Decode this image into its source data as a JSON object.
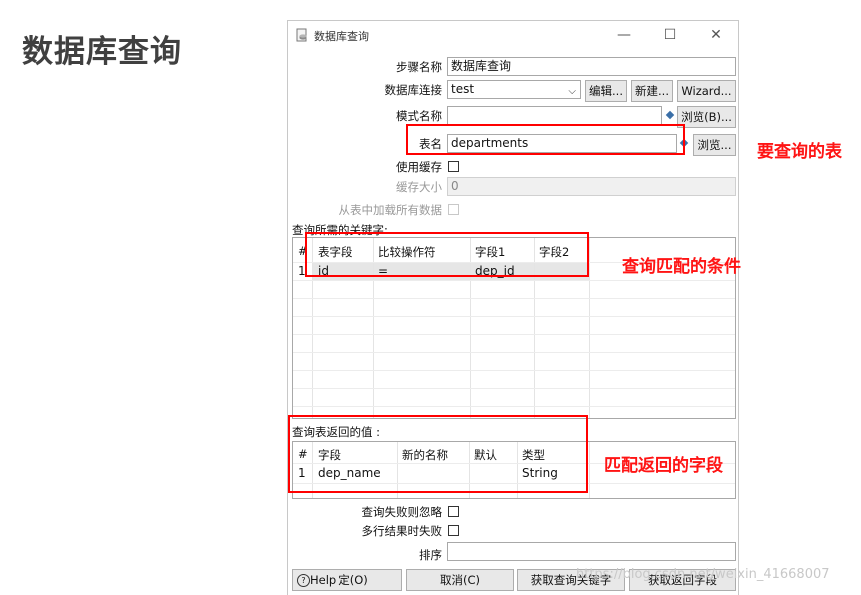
{
  "slide": {
    "title": "数据库查询"
  },
  "window": {
    "title": "数据库查询",
    "minimize": "—",
    "maximize": "☐",
    "close": "✕"
  },
  "form": {
    "step_name_label": "步骤名称",
    "step_name_value": "数据库查询",
    "connection_label": "数据库连接",
    "connection_value": "test",
    "edit_button": "编辑...",
    "new_button": "新建...",
    "wizard_button": "Wizard...",
    "schema_label": "模式名称",
    "schema_value": "",
    "browse_schema_button": "浏览(B)...",
    "table_label": "表名",
    "table_value": "departments",
    "browse_table_button": "浏览...",
    "use_cache_label": "使用缓存",
    "use_cache_checked": false,
    "cache_size_label": "缓存大小",
    "cache_size_value": "0",
    "load_all_label": "从表中加载所有数据",
    "load_all_checked": false
  },
  "keys_section": {
    "label": "查询所需的关键字:",
    "columns": [
      "#",
      "表字段",
      "比较操作符",
      "字段1",
      "字段2"
    ],
    "rows": [
      {
        "num": "1",
        "table_field": "id",
        "comparator": "=",
        "field1": "dep_id",
        "field2": ""
      }
    ]
  },
  "return_section": {
    "label": "查询表返回的值 :",
    "columns": [
      "#",
      "字段",
      "新的名称",
      "默认",
      "类型"
    ],
    "rows": [
      {
        "num": "1",
        "field": "dep_name",
        "new_name": "",
        "default": "",
        "type": "String"
      }
    ]
  },
  "options": {
    "fail_ignore_label": "查询失败则忽略",
    "fail_ignore_checked": false,
    "multi_fail_label": "多行结果时失败",
    "multi_fail_checked": false,
    "order_label": "排序",
    "order_value": ""
  },
  "buttons": {
    "help": "Help",
    "ok_partial": "定(O)",
    "cancel": "取消(C)",
    "get_keys": "获取查询关键字",
    "get_fields": "获取返回字段"
  },
  "annotations": {
    "table": "要查询的表",
    "conditions": "查询匹配的条件",
    "return_fields": "匹配返回的字段"
  },
  "watermark": "https://blog.csdn.net/weixin_41668007",
  "colors": {
    "annotation_red": "#ff0000",
    "title_gray": "#404040"
  }
}
